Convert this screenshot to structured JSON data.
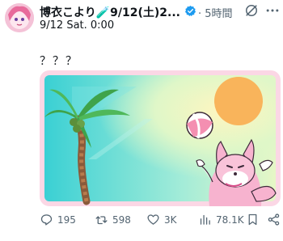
{
  "tweet": {
    "author_display_name": "博衣こより🧪9/12(土)2...",
    "posted_ago": "· 5時間",
    "subtitle": "9/12 Sat. 0:00",
    "text": "？？？"
  },
  "icons": {
    "verified": "verified-badge-icon",
    "top_action": "grok-icon",
    "menu": "more-icon",
    "reply": "reply-icon",
    "retweet": "retweet-icon",
    "like": "heart-icon",
    "views": "views-icon",
    "bookmark": "bookmark-icon",
    "share": "share-icon"
  },
  "engagement": {
    "replies": "195",
    "retweets": "598",
    "likes": "3K",
    "views": "78.1K"
  },
  "colors": {
    "verified": "#1d9bf0",
    "secondary_text": "#536471",
    "media_border": "#fbd7e5"
  }
}
